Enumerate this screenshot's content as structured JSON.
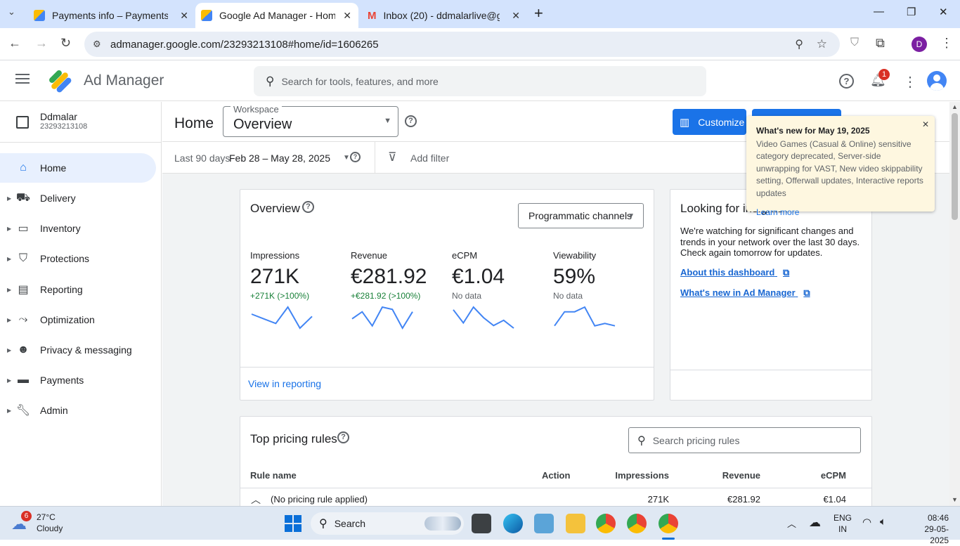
{
  "browser": {
    "tabs": [
      {
        "title": "Payments info – Payments – Go",
        "color": "#f9ab00"
      },
      {
        "title": "Google Ad Manager - Home",
        "color": "#f9ab00"
      },
      {
        "title": "Inbox (20) - ddmalarlive@gmai",
        "color": "#ea4335"
      }
    ],
    "url": "admanager.google.com/23293213108#home/id=1606265",
    "profile_initial": "D"
  },
  "app": {
    "name": "Ad Manager",
    "search_placeholder": "Search for tools, features, and more",
    "notification_count": "1"
  },
  "network": {
    "name": "Ddmalar",
    "id": "23293213108"
  },
  "sidebar": {
    "items": [
      {
        "label": "Home",
        "icon": "home-icon"
      },
      {
        "label": "Delivery",
        "icon": "truck-icon"
      },
      {
        "label": "Inventory",
        "icon": "inventory-icon"
      },
      {
        "label": "Protections",
        "icon": "shield-icon"
      },
      {
        "label": "Reporting",
        "icon": "bar-chart-icon"
      },
      {
        "label": "Optimization",
        "icon": "optimization-icon"
      },
      {
        "label": "Privacy & messaging",
        "icon": "privacy-icon"
      },
      {
        "label": "Payments",
        "icon": "payments-icon"
      },
      {
        "label": "Admin",
        "icon": "wrench-icon"
      }
    ]
  },
  "page": {
    "title": "Home",
    "workspace_label": "Workspace",
    "workspace_value": "Overview",
    "customize_label": "Customize",
    "date_range_label": "Last 90 days",
    "date_range_value": "Feb 28 – May 28, 2025",
    "add_filter": "Add filter"
  },
  "overview": {
    "title": "Overview",
    "channel_select": "Programmatic channels",
    "view_in_reporting": "View in reporting",
    "metrics": [
      {
        "label": "Impressions",
        "value": "271K",
        "change": "+271K (>100%)",
        "change_color": "#188038",
        "spark": [
          6,
          4,
          2,
          9,
          0,
          5
        ]
      },
      {
        "label": "Revenue",
        "value": "€281.92",
        "change": "+€281.92 (>100%)",
        "change_color": "#188038",
        "spark": [
          4,
          7,
          1,
          9,
          8,
          0,
          7
        ]
      },
      {
        "label": "eCPM",
        "value": "€1.04",
        "change": "No data",
        "change_color": "#5f6368",
        "spark": [
          7,
          2,
          8,
          4,
          1,
          3,
          0
        ]
      },
      {
        "label": "Viewability",
        "value": "59%",
        "change": "No data",
        "change_color": "#5f6368",
        "spark": [
          1,
          7,
          7,
          9,
          1,
          2,
          1
        ]
      }
    ]
  },
  "insights": {
    "title": "Looking for insights?",
    "body": "We're watching for significant changes and trends in your network over the last 30 days. Check again tomorrow for updates.",
    "link1": "About this dashboard",
    "link2": "What's new in Ad Manager"
  },
  "whatsnew": {
    "title": "What's new for May 19, 2025",
    "body": "Video Games (Casual & Online) sensitive category deprecated, Server-side unwrapping for VAST, New video skippability setting, Offerwall updates, Interactive reports updates",
    "link": "Learn more"
  },
  "pricing": {
    "title": "Top pricing rules",
    "search_placeholder": "Search pricing rules",
    "columns": [
      "Rule name",
      "Action",
      "Impressions",
      "Revenue",
      "eCPM"
    ],
    "rows": [
      {
        "name": "(No pricing rule applied)",
        "impressions": "271K",
        "revenue": "€281.92",
        "ecpm": "€1.04"
      }
    ]
  },
  "taskbar": {
    "weather_temp": "27°C",
    "weather_desc": "Cloudy",
    "weather_badge": "6",
    "search": "Search",
    "lang1": "ENG",
    "lang2": "IN",
    "time": "08:46",
    "date": "29-05-2025"
  }
}
